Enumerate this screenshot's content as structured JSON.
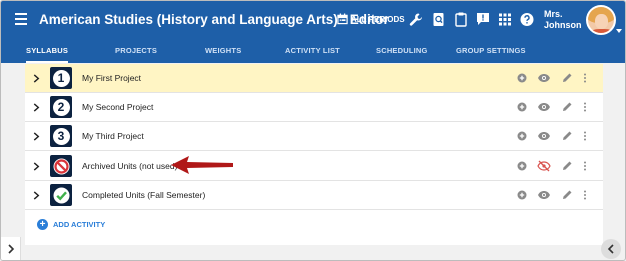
{
  "header": {
    "title": "American Studies (History and Language Arts) - Editor",
    "periods_label": "ALL PERIODS",
    "teacher_line1": "Mrs.",
    "teacher_line2": "Johnson",
    "icons": [
      "wrench-icon",
      "search-doc-icon",
      "clipboard-icon",
      "announcement-icon",
      "apps-grid-icon",
      "help-icon"
    ]
  },
  "tabs": [
    {
      "label": "SYLLABUS",
      "active": true
    },
    {
      "label": "PROJECTS",
      "active": false
    },
    {
      "label": "WEIGHTS",
      "active": false
    },
    {
      "label": "ACTIVITY LIST",
      "active": false
    },
    {
      "label": "SCHEDULING",
      "active": false
    },
    {
      "label": "GROUP SETTINGS",
      "active": false
    }
  ],
  "rows": [
    {
      "badge": "1",
      "label": "My First Project",
      "highlight": true,
      "hidden": false
    },
    {
      "badge": "2",
      "label": "My Second Project",
      "highlight": false,
      "hidden": false
    },
    {
      "badge": "3",
      "label": "My Third Project",
      "highlight": false,
      "hidden": false
    },
    {
      "badge": "no-entry-icon",
      "label": "Archived Units (not used)",
      "highlight": false,
      "hidden": true
    },
    {
      "badge": "check-icon",
      "label": "Completed Units (Fall Semester)",
      "highlight": false,
      "hidden": false
    }
  ],
  "add_activity_label": "ADD ACTIVITY",
  "colors": {
    "header": "#1e5fa8",
    "highlight_row": "#fff5c4",
    "badge": "#0c2240",
    "accent_blue": "#2a7ed8",
    "hidden_red": "#d9534f",
    "arrow_red": "#b01818",
    "check_green": "#3fb04a"
  }
}
